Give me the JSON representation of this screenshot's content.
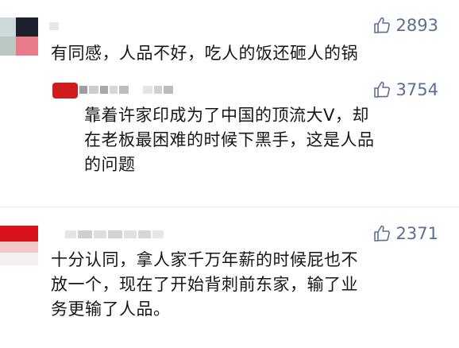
{
  "comments": [
    {
      "likes": "2893",
      "text": "有同感，人品不好，吃人的饭还砸人的锅"
    },
    {
      "likes": "3754",
      "text_lines": [
        "靠着许家印成为了中国的顶流大V，却",
        "在老板最困难的时候下黑手，这是人品",
        "的问题"
      ]
    },
    {
      "likes": "2371",
      "text_lines": [
        "十分认同，拿人家千万年薪的时候屁也不",
        "放一个，现在了开始背刺前东家，输了业",
        "务更输了人品。"
      ]
    }
  ],
  "colors": {
    "like_icon": "#5a6f94",
    "text": "#161616",
    "background": "#ffffff"
  },
  "icons": {
    "like": "thumbs-up-icon"
  }
}
